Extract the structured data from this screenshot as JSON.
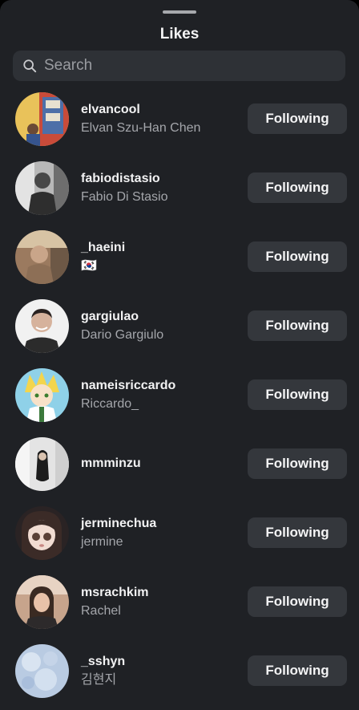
{
  "sheet": {
    "title": "Likes"
  },
  "search": {
    "placeholder": "Search",
    "icon": "search-icon"
  },
  "users": [
    {
      "username": "elvancool",
      "full_name": "Elvan Szu-Han Chen",
      "button_label": "Following"
    },
    {
      "username": "fabiodistasio",
      "full_name": "Fabio Di Stasio",
      "button_label": "Following"
    },
    {
      "username": "_haeini",
      "full_name": "🇰🇷",
      "button_label": "Following"
    },
    {
      "username": "gargiulao",
      "full_name": "Dario Gargiulo",
      "button_label": "Following"
    },
    {
      "username": "nameisriccardo",
      "full_name": "Riccardo_",
      "button_label": "Following"
    },
    {
      "username": "mmminzu",
      "full_name": "",
      "button_label": "Following"
    },
    {
      "username": "jerminechua",
      "full_name": "jermine",
      "button_label": "Following"
    },
    {
      "username": "msrachkim",
      "full_name": "Rachel",
      "button_label": "Following"
    },
    {
      "username": "_sshyn",
      "full_name": "김현지",
      "button_label": "Following"
    }
  ],
  "colors": {
    "sheet_background": "#1f2125",
    "search_background": "#2e3136",
    "button_background": "#34373c",
    "primary_text": "#f2f2f3",
    "secondary_text": "#a4a6ab"
  }
}
